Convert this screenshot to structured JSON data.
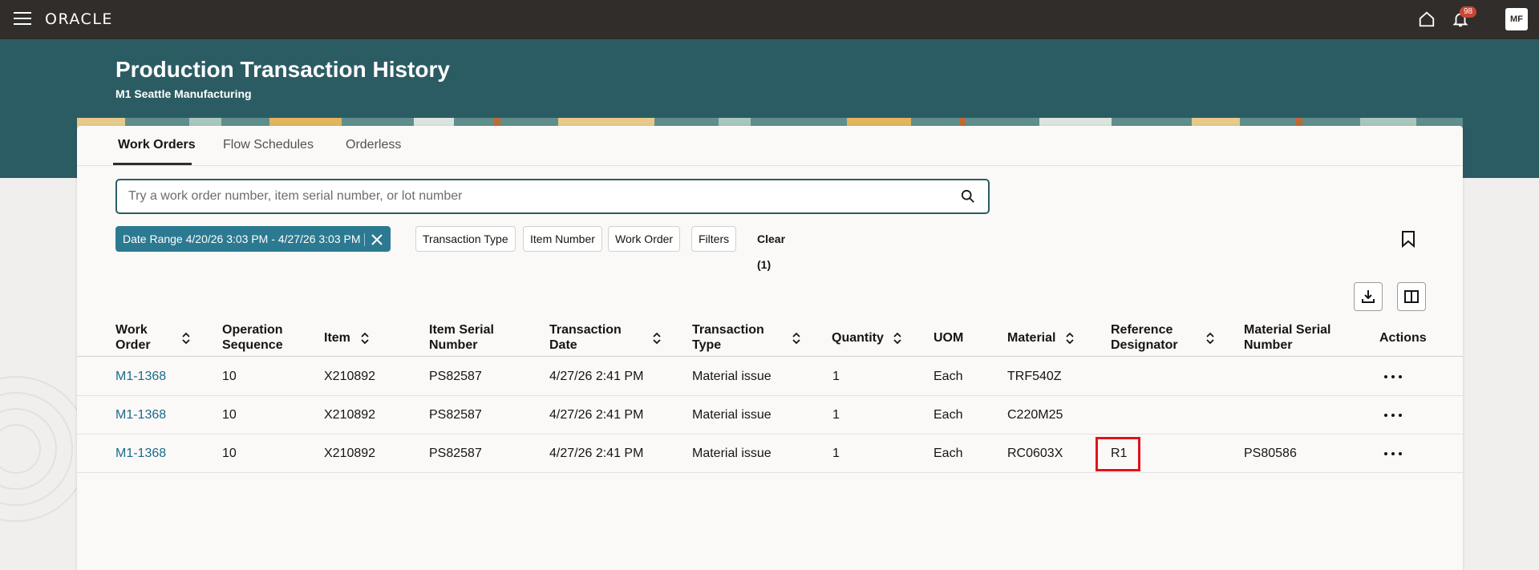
{
  "topbar": {
    "logo": "ORACLE",
    "notification_count": "98",
    "avatar_initials": "MF"
  },
  "header": {
    "title": "Production Transaction History",
    "subtitle": "M1 Seattle Manufacturing"
  },
  "tabs": [
    {
      "label": "Work Orders",
      "active": true
    },
    {
      "label": "Flow Schedules",
      "active": false
    },
    {
      "label": "Orderless",
      "active": false
    }
  ],
  "search": {
    "placeholder": "Try a work order number, item serial number, or lot number",
    "value": ""
  },
  "filters": {
    "date_range_chip": "Date Range 4/20/26 3:03 PM - 4/27/26 3:03 PM",
    "transaction_type": "Transaction Type",
    "item_number": "Item Number",
    "work_order": "Work Order",
    "filters": "Filters",
    "clear": "Clear (1)"
  },
  "table": {
    "columns": [
      {
        "label": "Work Order",
        "sortable": true
      },
      {
        "label": "Operation Sequence",
        "sortable": false
      },
      {
        "label": "Item",
        "sortable": true
      },
      {
        "label": "Item Serial Number",
        "sortable": false
      },
      {
        "label": "Transaction Date",
        "sortable": true
      },
      {
        "label": "Transaction Type",
        "sortable": true
      },
      {
        "label": "Quantity",
        "sortable": true
      },
      {
        "label": "UOM",
        "sortable": false
      },
      {
        "label": "Material",
        "sortable": true
      },
      {
        "label": "Reference Designator",
        "sortable": true
      },
      {
        "label": "Material Serial Number",
        "sortable": false
      },
      {
        "label": "Actions",
        "sortable": false
      }
    ],
    "rows": [
      {
        "work_order": "M1-1368",
        "op_seq": "10",
        "item": "X210892",
        "item_serial": "PS82587",
        "txn_date": "4/27/26 2:41 PM",
        "txn_type": "Material issue",
        "qty": "1",
        "uom": "Each",
        "material": "TRF540Z",
        "ref_designator": "",
        "material_serial": ""
      },
      {
        "work_order": "M1-1368",
        "op_seq": "10",
        "item": "X210892",
        "item_serial": "PS82587",
        "txn_date": "4/27/26 2:41 PM",
        "txn_type": "Material issue",
        "qty": "1",
        "uom": "Each",
        "material": "C220M25",
        "ref_designator": "",
        "material_serial": ""
      },
      {
        "work_order": "M1-1368",
        "op_seq": "10",
        "item": "X210892",
        "item_serial": "PS82587",
        "txn_date": "4/27/26 2:41 PM",
        "txn_type": "Material issue",
        "qty": "1",
        "uom": "Each",
        "material": "RC0603X",
        "ref_designator": "R1",
        "material_serial": "PS80586"
      }
    ]
  },
  "colors": {
    "topbar": "#312d2a",
    "header": "#2c5c63",
    "accent": "#2c7a91",
    "link": "#1a6b8a",
    "highlight": "#e0131a"
  }
}
